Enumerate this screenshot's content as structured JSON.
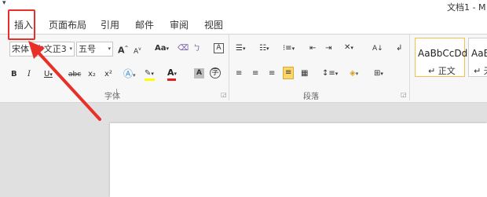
{
  "window": {
    "title": "文档1 - M"
  },
  "tabs": [
    {
      "label": "插入",
      "highlighted": true
    },
    {
      "label": "页面布局"
    },
    {
      "label": "引用"
    },
    {
      "label": "邮件"
    },
    {
      "label": "审阅"
    },
    {
      "label": "视图"
    }
  ],
  "font_group": {
    "label": "字体",
    "font_name": "宋体 (中文正3",
    "font_size": "五号",
    "grow_font": "A",
    "shrink_font": "A",
    "change_case": "Aa",
    "pinyin": "ㄅ",
    "char_border": "A",
    "bold": "B",
    "italic": "I",
    "underline": "U",
    "strikethrough": "abc",
    "subscript": "x₂",
    "superscript": "x²",
    "highlight_color": "#ffff00",
    "font_color": "#e02020",
    "char_shading": "A",
    "enclose": "字"
  },
  "paragraph_group": {
    "label": "段落",
    "sort": "A↓"
  },
  "styles_group": {
    "items": [
      {
        "sample": "AaBbCcDd",
        "name": "↵ 正文"
      },
      {
        "sample": "AaBb",
        "name": "↵ 无"
      }
    ]
  },
  "annotation": {
    "color": "#e82f28"
  }
}
